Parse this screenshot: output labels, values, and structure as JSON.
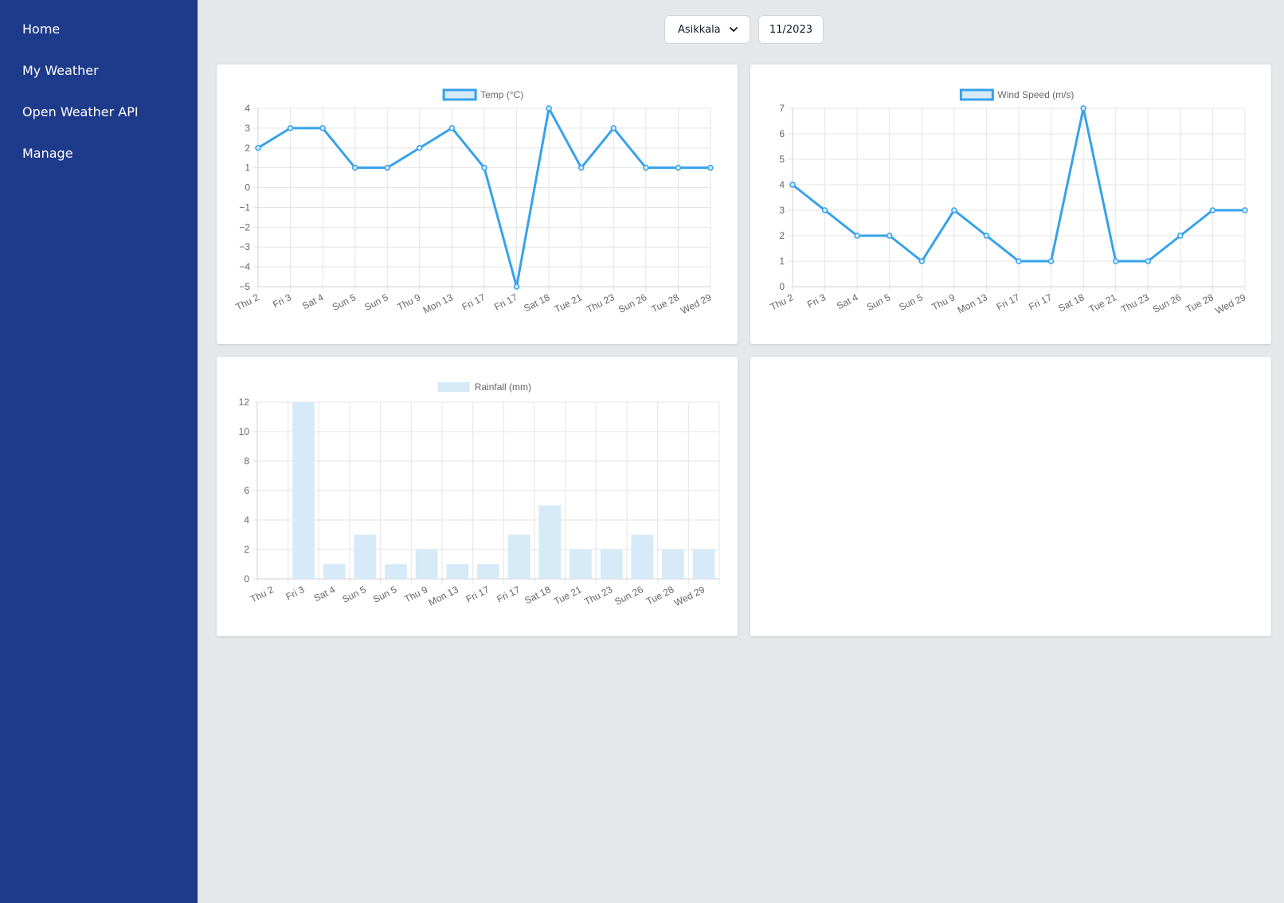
{
  "nav": {
    "items": [
      {
        "label": "Home"
      },
      {
        "label": "My Weather"
      },
      {
        "label": "Open Weather API"
      },
      {
        "label": "Manage"
      }
    ]
  },
  "controls": {
    "location": "Asikkala",
    "date": "11/2023"
  },
  "colors": {
    "sidebar": "#1e3a8a",
    "line": "#36a2eb",
    "bar_fill": "#d6eaf8",
    "background": "#e5e7eb"
  },
  "chart_data": [
    {
      "type": "line",
      "legend": "Temp (°C)",
      "categories": [
        "Thu 2",
        "Fri 3",
        "Sat 4",
        "Sun 5",
        "Sun 5",
        "Thu 9",
        "Mon 13",
        "Fri 17",
        "Fri 17",
        "Sat 18",
        "Tue 21",
        "Thu 23",
        "Sun 26",
        "Tue 28",
        "Wed 29"
      ],
      "values": [
        2,
        3,
        3,
        1,
        1,
        2,
        3,
        1,
        -5,
        4,
        1,
        3,
        1,
        1,
        1
      ],
      "ylim": [
        -5,
        4
      ],
      "yticks": [
        4,
        3,
        2,
        1,
        0,
        -1,
        -2,
        -3,
        -4,
        -5
      ],
      "grid": true,
      "legend_position": "top"
    },
    {
      "type": "line",
      "legend": "Wind Speed (m/s)",
      "categories": [
        "Thu 2",
        "Fri 3",
        "Sat 4",
        "Sun 5",
        "Sun 5",
        "Thu 9",
        "Mon 13",
        "Fri 17",
        "Fri 17",
        "Sat 18",
        "Tue 21",
        "Thu 23",
        "Sun 26",
        "Tue 28",
        "Wed 29"
      ],
      "values": [
        4,
        3,
        2,
        2,
        1,
        3,
        2,
        1,
        1,
        7,
        1,
        1,
        2,
        3,
        3
      ],
      "ylim": [
        0,
        7
      ],
      "yticks": [
        7,
        6,
        5,
        4,
        3,
        2,
        1,
        0
      ],
      "grid": true,
      "legend_position": "top"
    },
    {
      "type": "bar",
      "legend": "Rainfall (mm)",
      "categories": [
        "Thu 2",
        "Fri 3",
        "Sat 4",
        "Sun 5",
        "Sun 5",
        "Thu 9",
        "Mon 13",
        "Fri 17",
        "Fri 17",
        "Sat 18",
        "Tue 21",
        "Thu 23",
        "Sun 26",
        "Tue 28",
        "Wed 29"
      ],
      "values": [
        0,
        12,
        1,
        3,
        1,
        2,
        1,
        1,
        3,
        5,
        2,
        2,
        3,
        2,
        2
      ],
      "ylim": [
        0,
        12
      ],
      "yticks": [
        12,
        10,
        8,
        6,
        4,
        2,
        0
      ],
      "grid": true,
      "legend_position": "top"
    }
  ]
}
